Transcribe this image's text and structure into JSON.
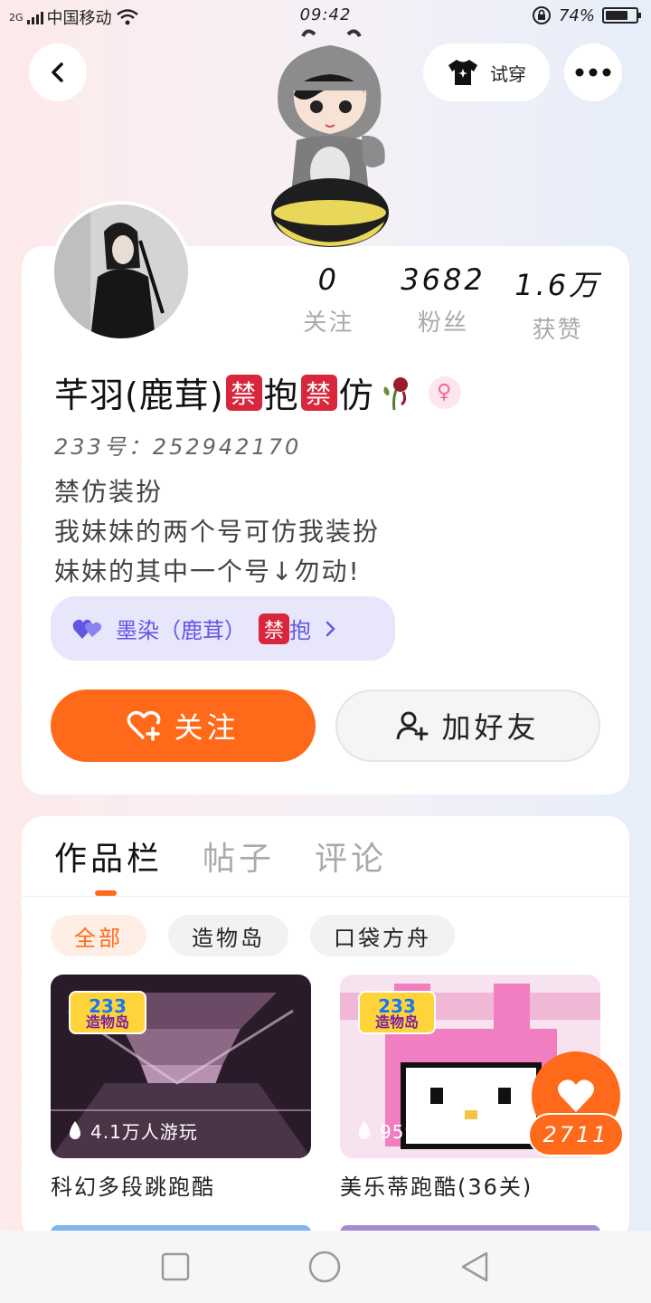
{
  "status_bar": {
    "network": "2G",
    "carrier": "中国移动",
    "time": "09:42",
    "battery": "74%",
    "battery_level": 0.74
  },
  "header": {
    "back_icon": "chevron-left-icon",
    "tryon_label": "试穿",
    "more_icon": "more-dots-icon"
  },
  "profile": {
    "stats": [
      {
        "value": "0",
        "label": "关注"
      },
      {
        "value": "3682",
        "label": "粉丝"
      },
      {
        "value": "1.6万",
        "label": "获赞"
      }
    ],
    "nickname_parts": [
      "芊羽(鹿茸)",
      "禁",
      "抱",
      "禁",
      "仿"
    ],
    "uid": "233号：252942170",
    "bio": [
      "禁仿装扮",
      "我妹妹的两个号可仿我装扮",
      "妹妹的其中一个号↓勿动!"
    ],
    "linked_account": {
      "name": "墨染（鹿茸）",
      "badge": "禁",
      "suffix": "抱"
    },
    "follow_label": "关注",
    "add_friend_label": "加好友"
  },
  "works": {
    "tabs": [
      "作品栏",
      "帖子",
      "评论"
    ],
    "chips": [
      "全部",
      "造物岛",
      "口袋方舟"
    ],
    "logo_text": {
      "top": "233",
      "bottom": "造物岛"
    },
    "games": [
      {
        "title": "科幻多段跳跑酷",
        "plays": "4.1万人游玩"
      },
      {
        "title": "美乐蒂跑酷(36关)",
        "plays": "9590人游玩"
      }
    ],
    "like_count": "2711"
  },
  "colors": {
    "accent": "#ff6a1a",
    "linked_bg": "#e7e6fb",
    "linked_text": "#6257e3",
    "ban_red": "#d8263c"
  }
}
